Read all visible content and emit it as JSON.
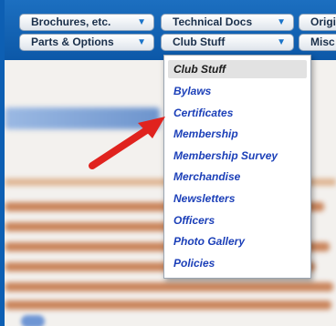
{
  "nav": {
    "row1": [
      {
        "label": "Brochures, etc."
      },
      {
        "label": "Technical Docs"
      },
      {
        "label": "Origi"
      }
    ],
    "row2": [
      {
        "label": "Parts & Options"
      },
      {
        "label": "Club Stuff"
      },
      {
        "label": "Misc"
      }
    ]
  },
  "dropdown": {
    "items": [
      {
        "label": "Club Stuff"
      },
      {
        "label": "Bylaws"
      },
      {
        "label": "Certificates"
      },
      {
        "label": "Membership"
      },
      {
        "label": "Membership Survey"
      },
      {
        "label": "Merchandise"
      },
      {
        "label": "Newsletters"
      },
      {
        "label": "Officers"
      },
      {
        "label": "Photo Gallery"
      },
      {
        "label": "Policies"
      }
    ]
  },
  "colors": {
    "nav_background": "#0c58a8",
    "menu_link": "#1b3fb8",
    "arrow": "#e0231e"
  },
  "icons": {
    "caret": "chevron-down-icon",
    "pointer": "red-arrow-icon"
  }
}
